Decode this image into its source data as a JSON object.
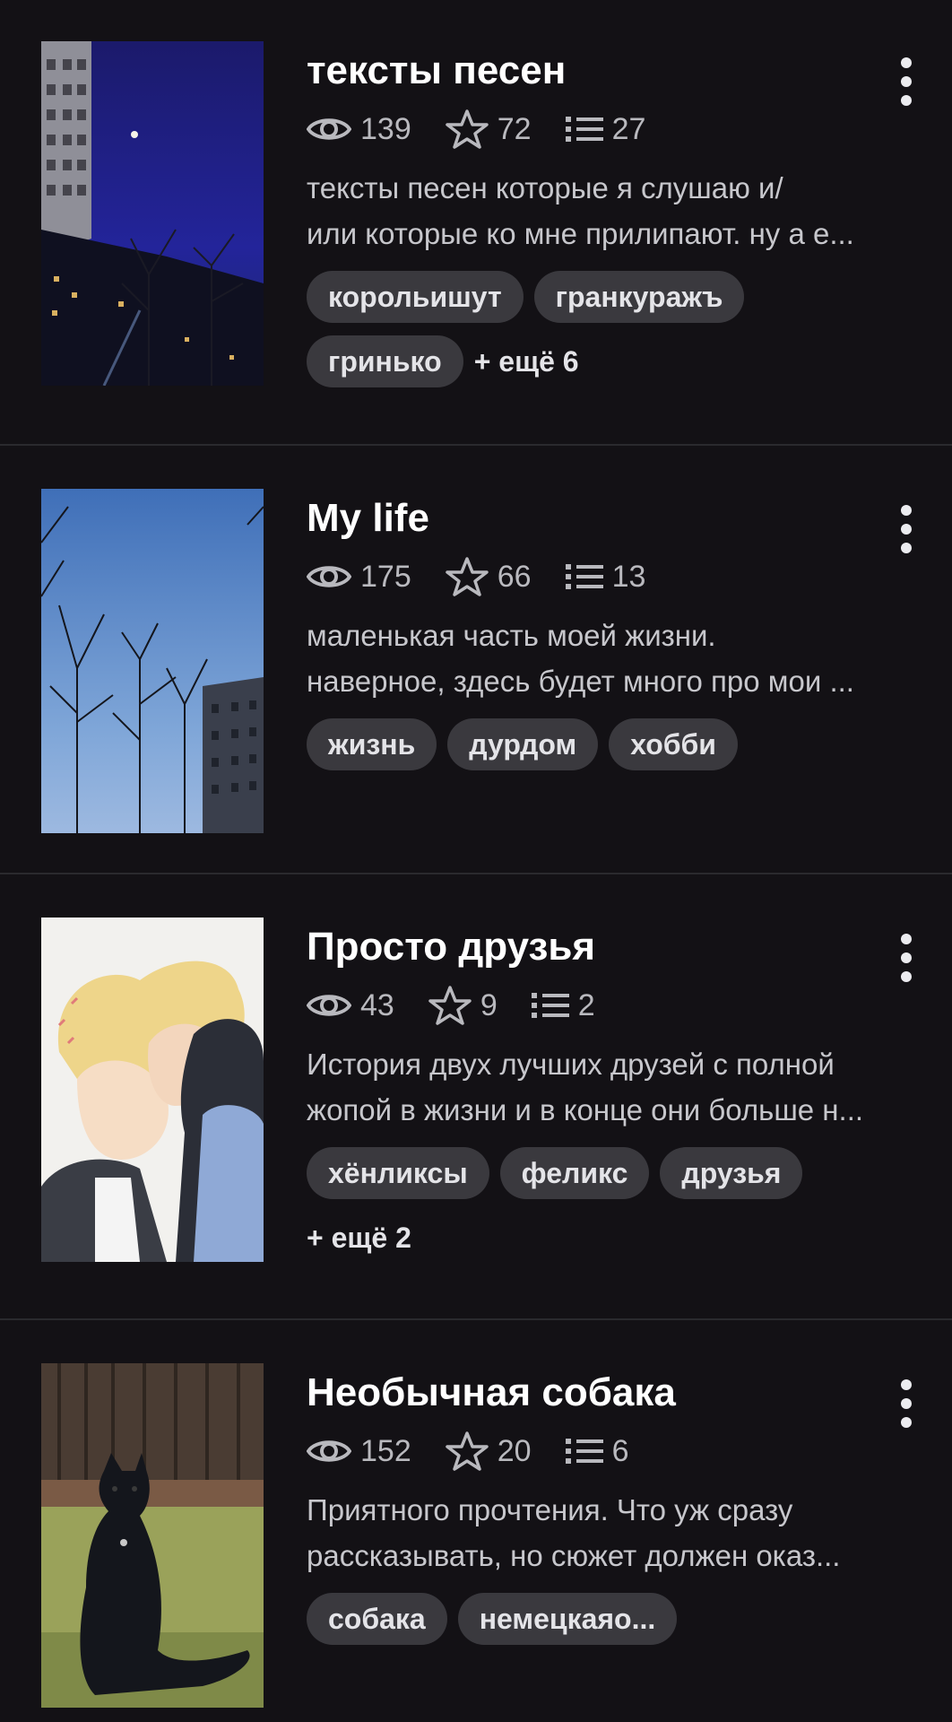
{
  "items": [
    {
      "title": "тексты песен",
      "views": "139",
      "stars": "72",
      "parts": "27",
      "desc_line1": "тексты песен которые я слушаю и/",
      "desc_line2": "или которые ко мне прилипают. ну а е...",
      "tags": [
        "корольишут",
        "гранкуражъ",
        "гринько"
      ],
      "more": "+ ещё 6"
    },
    {
      "title": "My life",
      "views": "175",
      "stars": "66",
      "parts": "13",
      "desc_line1": "маленькая часть моей жизни.",
      "desc_line2": "наверное, здесь будет много про мои ...",
      "tags": [
        "жизнь",
        "дурдом",
        "хобби"
      ],
      "more": ""
    },
    {
      "title": "Просто друзья",
      "views": "43",
      "stars": "9",
      "parts": "2",
      "desc_line1": "История двух лучших друзей с полной",
      "desc_line2": "жопой в жизни и в конце они больше н...",
      "tags": [
        "хёнликсы",
        "феликс",
        "друзья"
      ],
      "more": "+ ещё 2"
    },
    {
      "title": "Необычная собака",
      "views": "152",
      "stars": "20",
      "parts": "6",
      "desc_line1": "Приятного прочтения. Что уж сразу",
      "desc_line2": "рассказывать, но сюжет должен оказ...",
      "tags": [
        "собака",
        "немецкаяо..."
      ],
      "more": ""
    }
  ],
  "icons": {
    "views": "eye-icon",
    "stars": "star-icon",
    "parts": "list-icon",
    "menu": "more-vertical-icon"
  },
  "colors": {
    "background": "#131115",
    "tag_bg": "#3a393e",
    "meta": "#b9b9be"
  }
}
